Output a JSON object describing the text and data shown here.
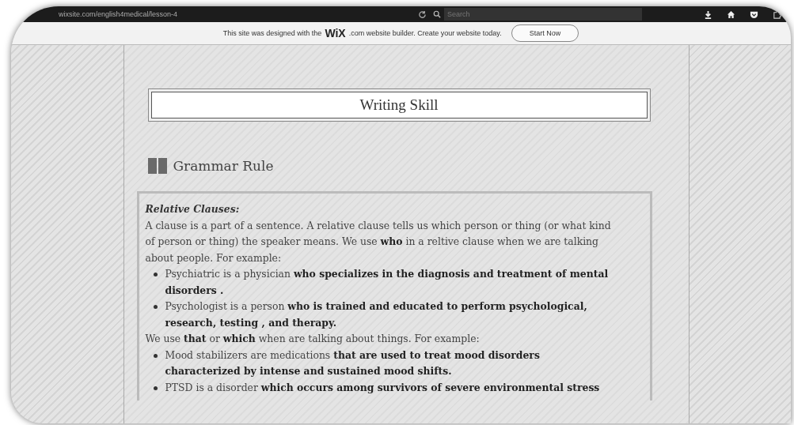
{
  "browser": {
    "url": "wixsite.com/english4medical/lesson-4",
    "search": {
      "placeholder": "Search"
    }
  },
  "banner": {
    "text_before": "This site was designed with the",
    "logo": "WiX",
    "text_after": ".com website builder. Create your website today.",
    "button": "Start Now"
  },
  "page": {
    "title": "Writing Skill",
    "section_heading": "Grammar Rule",
    "content": {
      "heading": "Relative Clauses:",
      "blocks": [
        {
          "kind": "paragraph",
          "text": "A clause is a part of a sentence. A relative clause tells us which person or thing (or what kind of person or thing) the speaker means. We use **who** in a reltive clause when we are talking about people. For example:"
        },
        {
          "kind": "bullet",
          "text": "Psychiatric is a physician **who specializes in the diagnosis and treatment of mental disorders .**"
        },
        {
          "kind": "bullet",
          "text": "Psychologist is a person **who is trained and educated to perform psychological, research, testing , and therapy.**"
        },
        {
          "kind": "paragraph",
          "text": "We use **that** or **which** when are talking about things. For example:"
        },
        {
          "kind": "bullet",
          "text": "Mood stabilizers are medications **that are used to treat mood disorders characterized by intense and sustained mood shifts.**"
        },
        {
          "kind": "bullet",
          "text": "PTSD is a disorder **which occurs among survivors of severe environmental stress**"
        }
      ]
    }
  }
}
